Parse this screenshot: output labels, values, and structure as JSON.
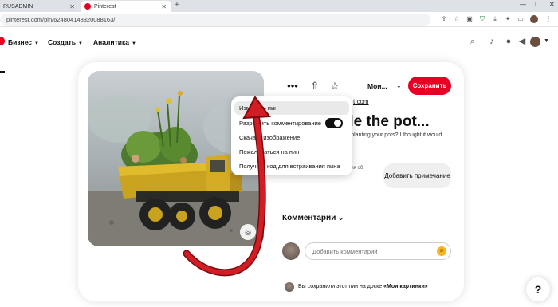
{
  "browser": {
    "tabs": [
      {
        "title": "RUSADMIN",
        "active": false
      },
      {
        "title": "Pinterest",
        "active": true
      }
    ],
    "url": "pinterest.com/pin/624804148320088163/"
  },
  "header": {
    "nav": [
      {
        "label": "Бизнес"
      },
      {
        "label": "Создать"
      },
      {
        "label": "Аналитика"
      }
    ]
  },
  "pin": {
    "board_label": "Мои...",
    "save_label": "Сохранить",
    "link_fragment": "t.com",
    "title_fragment": "de the pot...",
    "description_fragment": "rt planting your pots? I thought it would",
    "description_fragment2": "ния об",
    "note_button": "Добавить примечание"
  },
  "menu": {
    "items": [
      {
        "label": "Изменить пин"
      },
      {
        "label": "Разрешить комментирование"
      },
      {
        "label": "Скачать изображение"
      },
      {
        "label": "Пожаловаться на пин"
      },
      {
        "label": "Получить код для встраивания пина"
      }
    ],
    "comments_toggle_on": true
  },
  "comments": {
    "heading": "Комментарии",
    "placeholder": "Добавить комментарий"
  },
  "saved_note": {
    "text": "Вы сохранили этот пин на доске ",
    "board": "«Мои картинки»"
  },
  "help_label": "?",
  "colors": {
    "accent": "#e60023",
    "arrow": "#c8121a"
  }
}
